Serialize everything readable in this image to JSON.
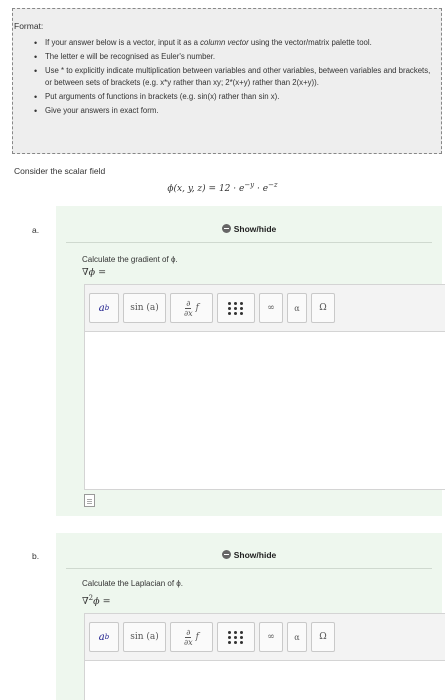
{
  "format": {
    "title": "Format:",
    "items": [
      "If your answer below is a vector, input it as a |column vector| using the vector/matrix palette tool.",
      "The letter e will be recognised as Euler's number.",
      "Use * to explicitly indicate multiplication between variables and other variables, between variables and brackets, or between sets of brackets (e.g. x*y rather than xy; 2*(x+y) rather than 2(x+y)).",
      "Put arguments of functions in brackets (e.g. sin(x) rather than sin x).",
      "Give your answers in exact form."
    ]
  },
  "intro": "Consider the scalar field",
  "field_formula": {
    "lhs": "ϕ(x, y, z) = 12 · e",
    "exp1": "−y",
    "mid": " · e",
    "exp2": "−z"
  },
  "parts": [
    {
      "letter": "a.",
      "toggle": "Show/hide",
      "prompt": "Calculate the gradient of ϕ.",
      "math_label": "∇ϕ ="
    },
    {
      "letter": "b.",
      "toggle": "Show/hide",
      "prompt": "Calculate the Laplacian of ϕ.",
      "math_label_base": "∇",
      "math_label_sup": "2",
      "math_label_rest": "ϕ ="
    }
  ],
  "toolbar": {
    "power_base": "a",
    "power_exp": "b",
    "function": "sin (a)",
    "deriv_num": "∂",
    "deriv_den": "∂x",
    "deriv_f": "f",
    "infinity": "∞",
    "alpha": "α",
    "omega": "Ω"
  }
}
